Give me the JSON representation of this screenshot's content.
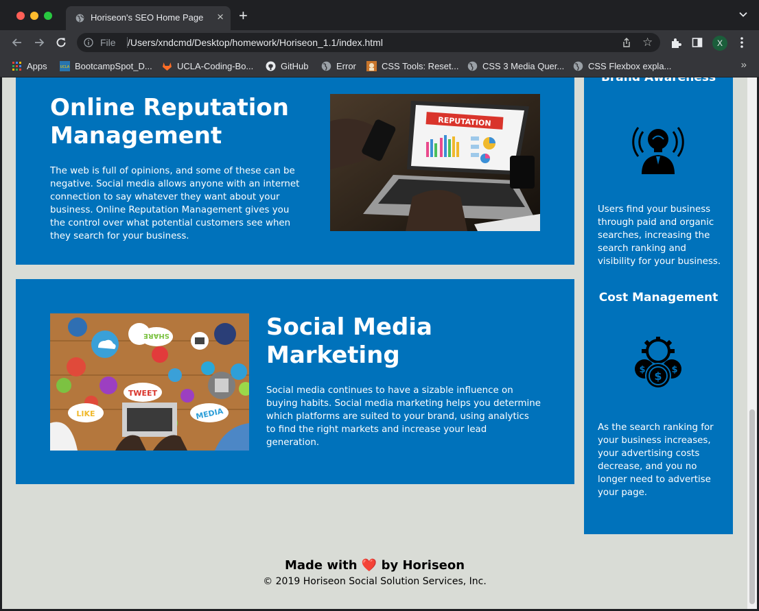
{
  "browser": {
    "tab_title": "Horiseon's SEO Home Page",
    "new_tab": "+",
    "scheme": "File",
    "url": "/Users/xndcmd/Desktop/homework/Horiseon_1.1/index.html",
    "profile_initial": "X",
    "bookmarks": [
      {
        "label": "Apps",
        "icon": "apps-grid-icon"
      },
      {
        "label": "BootcampSpot_D...",
        "icon": "ucla-icon"
      },
      {
        "label": "UCLA-Coding-Bo...",
        "icon": "gitlab-icon"
      },
      {
        "label": "GitHub",
        "icon": "github-icon"
      },
      {
        "label": "Error",
        "icon": "globe-icon"
      },
      {
        "label": "CSS Tools: Reset...",
        "icon": "meyerweb-icon"
      },
      {
        "label": "CSS 3 Media Quer...",
        "icon": "globe-icon"
      },
      {
        "label": "CSS Flexbox expla...",
        "icon": "globe-icon"
      }
    ],
    "bookmarks_overflow": "»"
  },
  "page": {
    "sections": [
      {
        "title_line1": "Online Reputation",
        "title_line2": "Management",
        "text": "The web is full of opinions, and some of these can be negative. Social media allows anyone with an internet connection to say whatever they want about your business. Online Reputation Management gives you the control over what potential customers see when they search for your business.",
        "image_label": "REPUTATION"
      },
      {
        "title_line1": "Social Media",
        "title_line2": "Marketing",
        "text": "Social media continues to have a sizable influence on buying habits. Social media marketing helps you determine which platforms are suited to your brand, using analytics to find the right markets and increase your lead generation.",
        "image_words": [
          "SHARE",
          "TWEET",
          "LIKE",
          "MEDIA"
        ]
      }
    ],
    "sidebar": {
      "items": [
        {
          "heading": "Brand Awareness",
          "icon": "lightbulb-person-icon",
          "text": "Users find your business through paid and organic searches, increasing the search ranking and visibility for your business."
        },
        {
          "heading": "Cost Management",
          "icon": "money-gear-icon",
          "text": "As the search ranking for your business increases, your advertising costs decrease, and you no longer need to advertise your page."
        }
      ]
    },
    "footer": {
      "made_with": "Made with",
      "heart": "❤️",
      "by": "by Horiseon",
      "copyright": "© 2019 Horiseon Social Solution Services, Inc."
    }
  },
  "colors": {
    "section_blue": "#0072bb",
    "page_bg": "#d9dcd6",
    "chrome_dark": "#1f2023",
    "chrome_toolbar": "#35363a"
  }
}
